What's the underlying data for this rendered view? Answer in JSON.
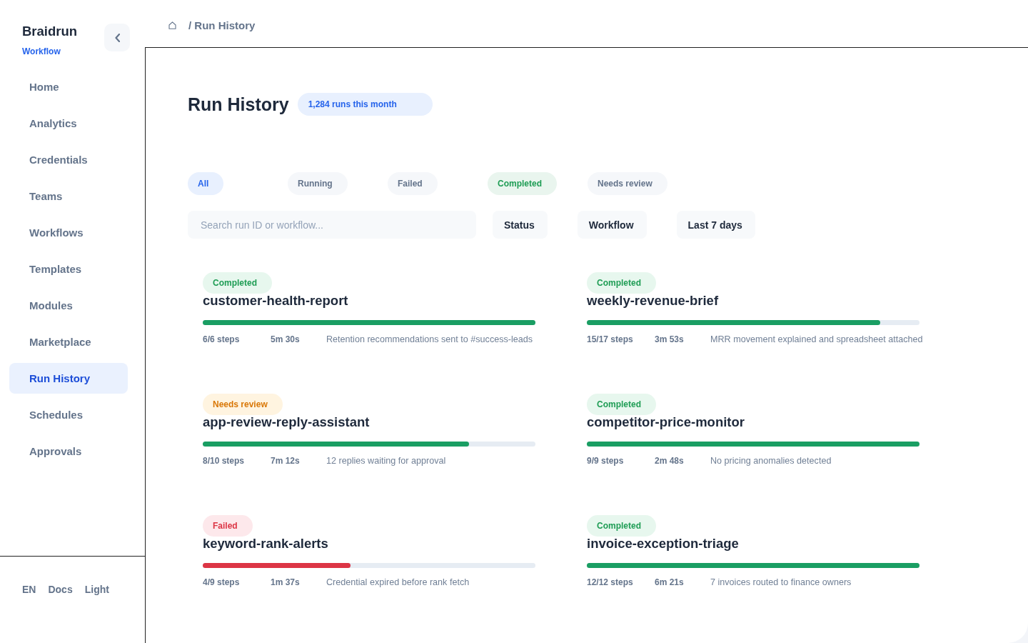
{
  "sidebar": {
    "brand": "Braidrun",
    "subtitle": "Workflow",
    "items": [
      {
        "label": "Home",
        "selected": false
      },
      {
        "label": "Analytics",
        "selected": false
      },
      {
        "label": "Credentials",
        "selected": false
      },
      {
        "label": "Teams",
        "selected": false
      },
      {
        "label": "Workflows",
        "selected": false
      },
      {
        "label": "Templates",
        "selected": false
      },
      {
        "label": "Modules",
        "selected": false
      },
      {
        "label": "Marketplace",
        "selected": false
      },
      {
        "label": "Run History",
        "selected": true
      },
      {
        "label": "Schedules",
        "selected": false
      },
      {
        "label": "Approvals",
        "selected": false
      }
    ],
    "footer": [
      "EN",
      "Docs",
      "Light"
    ]
  },
  "breadcrumb": {
    "current": "/ Run History"
  },
  "page": {
    "title": "Run History",
    "badge": "1,284 runs this month"
  },
  "filters": [
    {
      "label": "All",
      "selected": true
    },
    {
      "label": "Running",
      "selected": false
    },
    {
      "label": "Failed",
      "selected": false
    },
    {
      "label": "Completed",
      "selected": false,
      "color": "#1f9d55"
    },
    {
      "label": "Needs review",
      "selected": false
    }
  ],
  "search": {
    "placeholder": "Search run ID or workflow..."
  },
  "dropdowns": [
    "Status",
    "Workflow",
    "Last 7 days"
  ],
  "runs": [
    {
      "status": {
        "label": "Completed",
        "kind": "completed"
      },
      "name": "customer-health-report",
      "level": 1,
      "steps": "6/6 steps",
      "duration": "5m 30s",
      "summary": "Retention recommendations sent to #success-leads"
    },
    {
      "status": {
        "label": "Completed",
        "kind": "completed"
      },
      "name": "weekly-revenue-brief",
      "level": 0.882,
      "steps": "15/17 steps",
      "duration": "3m 53s",
      "summary": "MRR movement explained and spreadsheet attached"
    },
    {
      "status": {
        "label": "Needs review",
        "kind": "needs_review"
      },
      "name": "app-review-reply-assistant",
      "level": 0.8,
      "steps": "8/10 steps",
      "duration": "7m 12s",
      "summary": "12 replies waiting for approval"
    },
    {
      "status": {
        "label": "Completed",
        "kind": "completed"
      },
      "name": "competitor-price-monitor",
      "level": 1,
      "steps": "9/9 steps",
      "duration": "2m 48s",
      "summary": "No pricing anomalies detected"
    },
    {
      "status": {
        "label": "Failed",
        "kind": "failed"
      },
      "name": "keyword-rank-alerts",
      "level": 0.444,
      "steps": "4/9 steps",
      "duration": "1m 37s",
      "summary": "Credential expired before rank fetch"
    },
    {
      "status": {
        "label": "Completed",
        "kind": "completed"
      },
      "name": "invoice-exception-triage",
      "level": 1,
      "steps": "12/12 steps",
      "duration": "6m 21s",
      "summary": "7 invoices routed to finance owners"
    }
  ]
}
